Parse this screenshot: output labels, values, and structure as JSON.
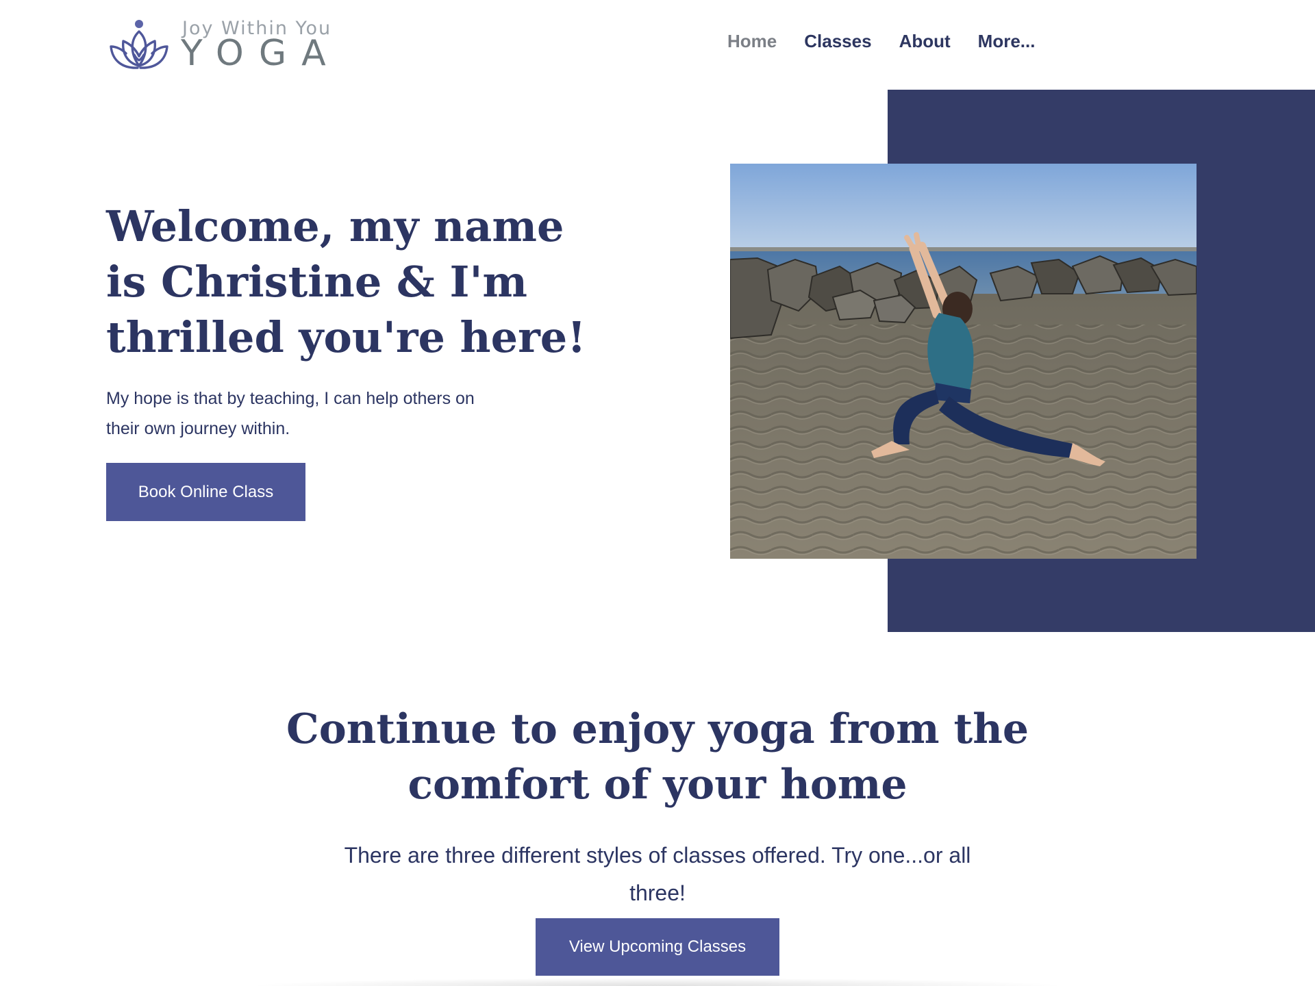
{
  "brand": {
    "tagline": "Joy Within You",
    "wordmark": "YOGA",
    "logo_icon": "lotus-icon",
    "colors": {
      "navy": "#2c3562",
      "accent_block": "#343c67",
      "button": "#4e5798",
      "logo_gray": "#6f797e"
    }
  },
  "nav": {
    "items": [
      {
        "label": "Home",
        "active": true
      },
      {
        "label": "Classes",
        "active": false
      },
      {
        "label": "About",
        "active": false
      },
      {
        "label": "More...",
        "active": false
      }
    ]
  },
  "hero": {
    "title": "Welcome, my name is Christine & I'm thrilled you're here!",
    "text": "My hope is that by teaching, I can help others on their own journey within.",
    "button_label": "Book Online Class",
    "photo": "photo of a woman in a low lunge yoga pose on a sandy beach by rocks and water"
  },
  "section": {
    "title": "Continue to enjoy yoga from the comfort of your home",
    "text": "There are three different styles of classes offered. Try one...or all three!",
    "button_label": "View Upcoming Classes"
  }
}
